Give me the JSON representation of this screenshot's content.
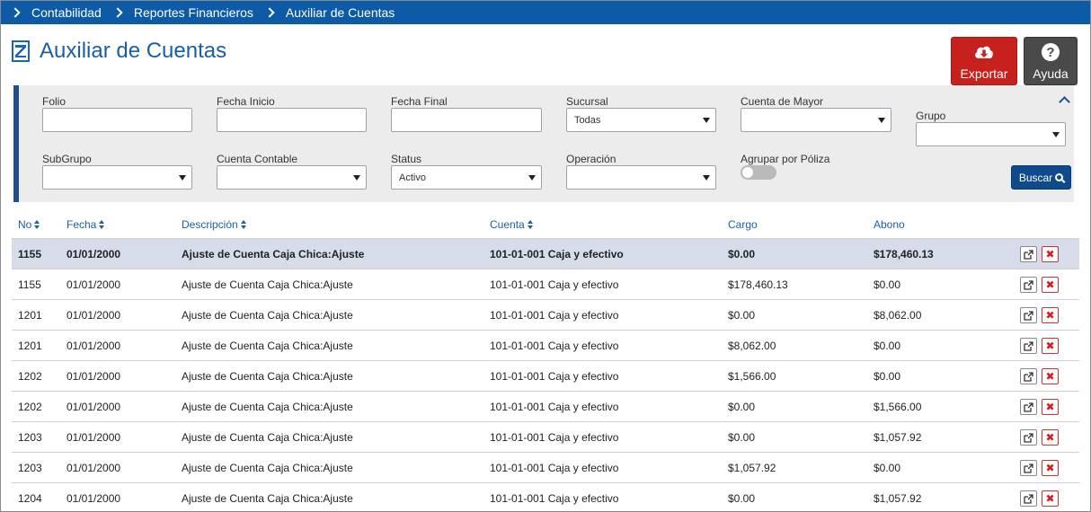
{
  "breadcrumb": [
    "Contabilidad",
    "Reportes Financieros",
    "Auxiliar de Cuentas"
  ],
  "page_title": "Auxiliar de Cuentas",
  "buttons": {
    "export": "Exportar",
    "help": "Ayuda",
    "search": "Buscar"
  },
  "filters": {
    "folio": {
      "label": "Folio",
      "value": ""
    },
    "fecha_inicio": {
      "label": "Fecha Inicio",
      "value": ""
    },
    "fecha_final": {
      "label": "Fecha Final",
      "value": ""
    },
    "sucursal": {
      "label": "Sucursal",
      "value": "Todas"
    },
    "cuenta_mayor": {
      "label": "Cuenta de Mayor",
      "value": ""
    },
    "grupo": {
      "label": "Grupo",
      "value": ""
    },
    "subgrupo": {
      "label": "SubGrupo",
      "value": ""
    },
    "cuenta_contable": {
      "label": "Cuenta Contable",
      "value": ""
    },
    "status": {
      "label": "Status",
      "value": "Activo"
    },
    "operacion": {
      "label": "Operación",
      "value": ""
    },
    "agrupar": {
      "label": "Agrupar por Póliza",
      "value": false
    }
  },
  "table": {
    "headers": {
      "no": "No",
      "fecha": "Fecha",
      "descripcion": "Descripción",
      "cuenta": "Cuenta",
      "cargo": "Cargo",
      "abono": "Abono"
    },
    "rows": [
      {
        "no": "1155",
        "fecha": "01/01/2000",
        "descripcion": "Ajuste de Cuenta Caja Chica:Ajuste",
        "cuenta": "101-01-001 Caja y efectivo",
        "cargo": "$0.00",
        "abono": "$178,460.13"
      },
      {
        "no": "1155",
        "fecha": "01/01/2000",
        "descripcion": "Ajuste de Cuenta Caja Chica:Ajuste",
        "cuenta": "101-01-001 Caja y efectivo",
        "cargo": "$178,460.13",
        "abono": "$0.00"
      },
      {
        "no": "1201",
        "fecha": "01/01/2000",
        "descripcion": "Ajuste de Cuenta Caja Chica:Ajuste",
        "cuenta": "101-01-001 Caja y efectivo",
        "cargo": "$0.00",
        "abono": "$8,062.00"
      },
      {
        "no": "1201",
        "fecha": "01/01/2000",
        "descripcion": "Ajuste de Cuenta Caja Chica:Ajuste",
        "cuenta": "101-01-001 Caja y efectivo",
        "cargo": "$8,062.00",
        "abono": "$0.00"
      },
      {
        "no": "1202",
        "fecha": "01/01/2000",
        "descripcion": "Ajuste de Cuenta Caja Chica:Ajuste",
        "cuenta": "101-01-001 Caja y efectivo",
        "cargo": "$1,566.00",
        "abono": "$0.00"
      },
      {
        "no": "1202",
        "fecha": "01/01/2000",
        "descripcion": "Ajuste de Cuenta Caja Chica:Ajuste",
        "cuenta": "101-01-001 Caja y efectivo",
        "cargo": "$0.00",
        "abono": "$1,566.00"
      },
      {
        "no": "1203",
        "fecha": "01/01/2000",
        "descripcion": "Ajuste de Cuenta Caja Chica:Ajuste",
        "cuenta": "101-01-001 Caja y efectivo",
        "cargo": "$0.00",
        "abono": "$1,057.92"
      },
      {
        "no": "1203",
        "fecha": "01/01/2000",
        "descripcion": "Ajuste de Cuenta Caja Chica:Ajuste",
        "cuenta": "101-01-001 Caja y efectivo",
        "cargo": "$1,057.92",
        "abono": "$0.00"
      },
      {
        "no": "1204",
        "fecha": "01/01/2000",
        "descripcion": "Ajuste de Cuenta Caja Chica:Ajuste",
        "cuenta": "101-01-001 Caja y efectivo",
        "cargo": "$0.00",
        "abono": "$1,057.92"
      }
    ]
  },
  "icons": {
    "breadcrumb_separator": "chevron-right-icon",
    "title": "report-icon",
    "export": "cloud-download-icon",
    "help": "question-circle-icon",
    "collapse": "chevron-up-icon",
    "search": "search-icon",
    "sort": "sort-icon",
    "edit": "external-link-icon",
    "delete": "close-icon"
  },
  "colors": {
    "nav_bar": "#0d5aa7",
    "title": "#1b5ea8",
    "export_button": "#c6211d",
    "help_button": "#4a4a4a",
    "search_button": "#0f4a8c",
    "filter_panel": "#ececec",
    "selected_row": "#d6dcea",
    "delete_icon": "#d12020"
  }
}
